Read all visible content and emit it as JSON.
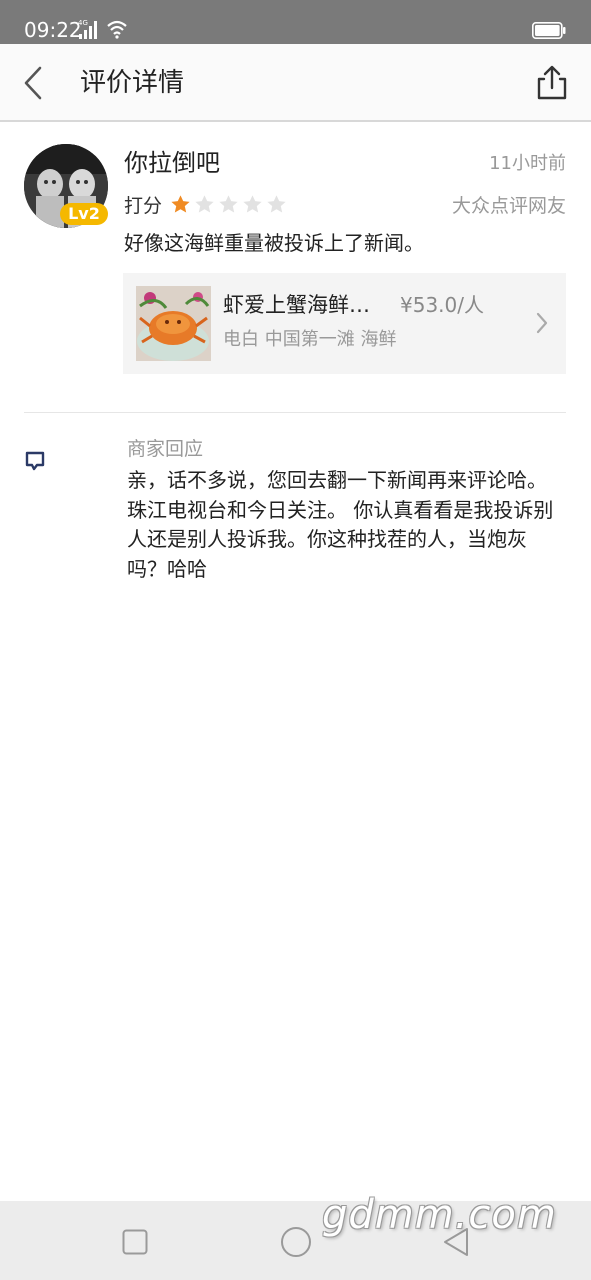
{
  "status_bar": {
    "time": "09:22",
    "network": "4G"
  },
  "header": {
    "title": "评价详情",
    "back_icon": "chevron-left-icon",
    "share_icon": "share-icon"
  },
  "review": {
    "user_name": "你拉倒吧",
    "level": "Lv2",
    "time": "11小时前",
    "score_label": "打分",
    "rating": 1,
    "rating_max": 5,
    "source": "大众点评网友",
    "text": "好像这海鲜重量被投诉上了新闻。"
  },
  "shop": {
    "name": "虾爱上蟹海鲜…",
    "price": "¥53.0/人",
    "meta": "电白 中国第一滩 海鲜"
  },
  "merchant_reply": {
    "title": "商家回应",
    "text": "亲，话不多说，您回去翻一下新闻再来评论哈。珠江电视台和今日关注。 你认真看看是我投诉别人还是别人投诉我。你这种找茬的人，当炮灰吗？哈哈"
  },
  "watermark": "gdmm.com",
  "colors": {
    "star_active": "#f08b23",
    "star_inactive": "#e2e2e2",
    "badge": "#f5b800",
    "reply_icon": "#2b3a66",
    "status_bar": "#7a7a7a"
  }
}
